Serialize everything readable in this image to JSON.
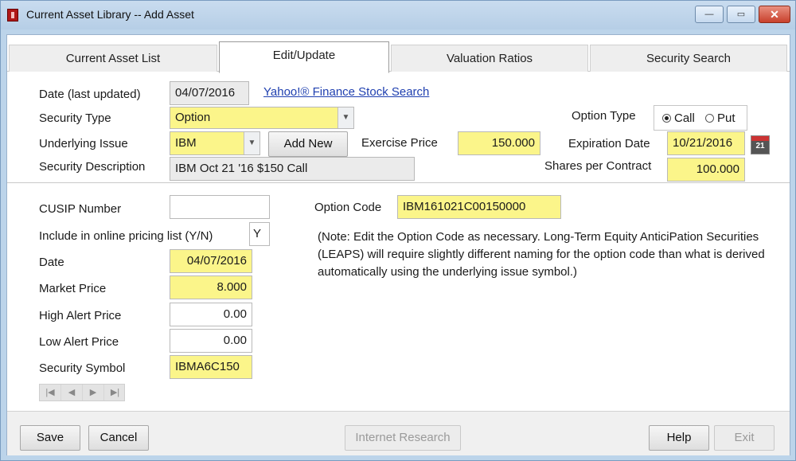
{
  "window": {
    "title": "Current Asset Library -- Add Asset",
    "controls": {
      "minimize": "—",
      "maximize": "▭",
      "close": "✕"
    }
  },
  "tabs": [
    {
      "label": "Current Asset List"
    },
    {
      "label": "Edit/Update"
    },
    {
      "label": "Valuation Ratios"
    },
    {
      "label": "Security Search"
    }
  ],
  "top_section": {
    "date_label": "Date (last updated)",
    "date_value": "04/07/2016",
    "finance_link": "Yahoo!® Finance Stock Search",
    "security_type_label": "Security Type",
    "security_type_value": "Option",
    "underlying_label": "Underlying Issue",
    "underlying_value": "IBM",
    "add_new_label": "Add New",
    "exercise_label": "Exercise Price",
    "exercise_value": "150.000",
    "description_label": "Security Description",
    "description_value": "IBM Oct 21 '16 $150 Call",
    "option_type_label": "Option Type",
    "option_call": "Call",
    "option_put": "Put",
    "option_selected": "Call",
    "expiration_label": "Expiration Date",
    "expiration_value": "10/21/2016",
    "calendar_text": "21",
    "shares_label": "Shares per Contract",
    "shares_value": "100.000"
  },
  "lower_section": {
    "cusip_label": "CUSIP Number",
    "cusip_value": "",
    "include_label": "Include in online pricing list  (Y/N)",
    "include_value": "Y",
    "date_label": "Date",
    "date_value": "04/07/2016",
    "market_price_label": "Market Price",
    "market_price_value": "8.000",
    "high_alert_label": "High Alert Price",
    "high_alert_value": "0.00",
    "low_alert_label": "Low Alert Price",
    "low_alert_value": "0.00",
    "symbol_label": "Security Symbol",
    "symbol_value": "IBMA6C150",
    "option_code_label": "Option Code",
    "option_code_value": "IBM161021C00150000",
    "note": "(Note: Edit the Option Code as necessary.  Long-Term Equity AnticiPation Securities (LEAPS) will require slightly different naming for the option code than what is derived automatically using the underlying issue symbol.)",
    "nav": [
      "|◀",
      "◀",
      "▶",
      "▶|"
    ]
  },
  "buttons": {
    "save": "Save",
    "cancel": "Cancel",
    "internet_research": "Internet Research",
    "help": "Help",
    "exit": "Exit"
  },
  "colors": {
    "required_field": "#fbf58a",
    "link": "#2040b0",
    "title_bar": "#c9dcef"
  }
}
